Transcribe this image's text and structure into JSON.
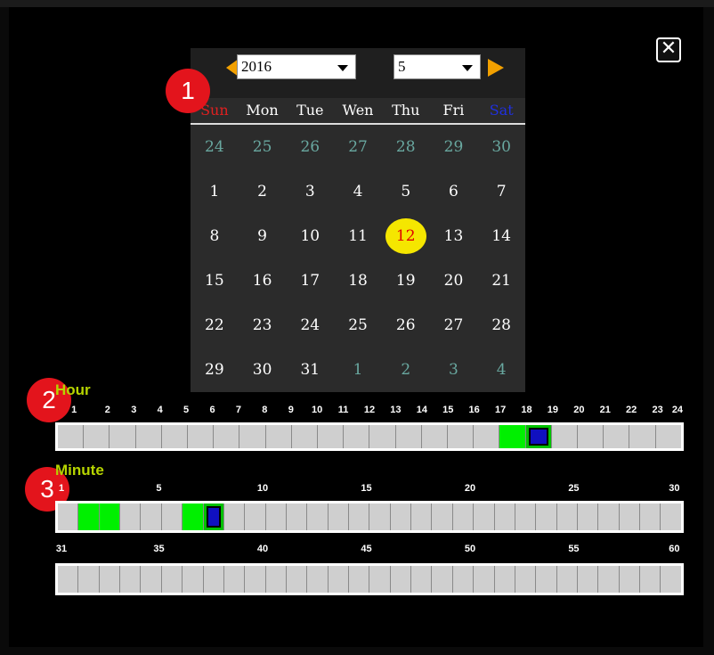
{
  "dialog": {
    "close_label": "✕"
  },
  "calendar": {
    "year": "2016",
    "month": "5",
    "weekdays": [
      "Sun",
      "Mon",
      "Tue",
      "Wen",
      "Thu",
      "Fri",
      "Sat"
    ],
    "weeks": [
      [
        "24",
        "25",
        "26",
        "27",
        "28",
        "29",
        "30"
      ],
      [
        "1",
        "2",
        "3",
        "4",
        "5",
        "6",
        "7"
      ],
      [
        "8",
        "9",
        "10",
        "11",
        "12",
        "13",
        "14"
      ],
      [
        "15",
        "16",
        "17",
        "18",
        "19",
        "20",
        "21"
      ],
      [
        "22",
        "23",
        "24",
        "25",
        "26",
        "27",
        "28"
      ],
      [
        "29",
        "30",
        "31",
        "1",
        "2",
        "3",
        "4"
      ]
    ],
    "selected_day": "12",
    "colors": {
      "sunday": "#e02020",
      "saturday": "#2030e0",
      "other_month": "#69a8a0",
      "selected_bg": "#f5e600",
      "selected_text": "#e00000",
      "arrow": "#f2a000"
    }
  },
  "badges": [
    "1",
    "2",
    "3"
  ],
  "hour": {
    "label": "Hour",
    "ticks": [
      "1",
      "2",
      "3",
      "4",
      "5",
      "6",
      "7",
      "8",
      "9",
      "10",
      "11",
      "12",
      "13",
      "14",
      "15",
      "16",
      "17",
      "18",
      "19",
      "20",
      "21",
      "22",
      "23",
      "24"
    ],
    "recorded": [
      18
    ],
    "cursor": 19
  },
  "minute": {
    "label": "Minute",
    "ticks_row1": [
      "1",
      "5",
      "10",
      "15",
      "20",
      "25",
      "30"
    ],
    "ticks_row2": [
      "31",
      "35",
      "40",
      "45",
      "50",
      "55",
      "60"
    ],
    "recorded": [
      2,
      3,
      7
    ],
    "cursor": 8
  },
  "colors": {
    "label": "#b6d400",
    "recorded": "#00f000",
    "cursor": "#1010c0",
    "badge": "#e3141c"
  }
}
